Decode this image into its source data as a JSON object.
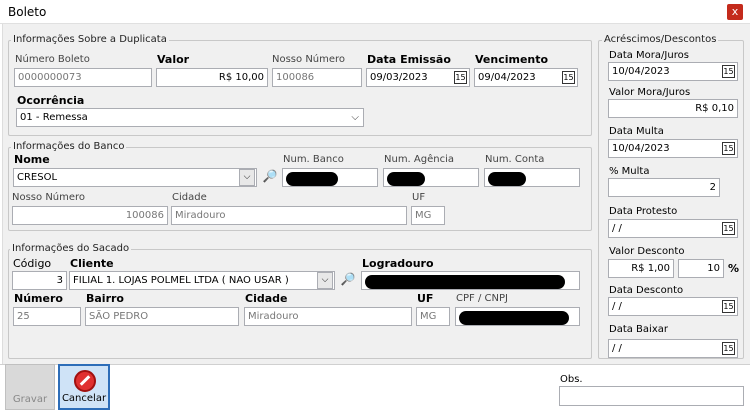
{
  "window": {
    "title": "Boleto",
    "close": "x"
  },
  "duplicata": {
    "group_label": "Informações Sobre a Duplicata",
    "numero_label": "Número Boleto",
    "numero_value": "0000000073",
    "valor_label": "Valor",
    "valor_value": "R$ 10,00",
    "nosso_label": "Nosso Número",
    "nosso_value": "100086",
    "emissao_label": "Data Emissão",
    "emissao_value": "09/03/2023",
    "vencimento_label": "Vencimento",
    "vencimento_value": "09/04/2023",
    "ocorrencia_label": "Ocorrência",
    "ocorrencia_value": "01 - Remessa"
  },
  "banco": {
    "group_label": "Informações do Banco",
    "nome_label": "Nome",
    "nome_value": "CRESOL",
    "num_banco_label": "Num. Banco",
    "num_agencia_label": "Num. Agência",
    "num_conta_label": "Num. Conta",
    "nosso_label": "Nosso Número",
    "nosso_value": "100086",
    "cidade_label": "Cidade",
    "cidade_value": "Miradouro",
    "uf_label": "UF",
    "uf_value": "MG"
  },
  "sacado": {
    "group_label": "Informações do Sacado",
    "codigo_label": "Código",
    "codigo_value": "3",
    "cliente_label": "Cliente",
    "cliente_value": "FILIAL 1. LOJAS POLMEL LTDA ( NAO USAR )",
    "logradouro_label": "Logradouro",
    "numero_label": "Número",
    "numero_value": "25",
    "bairro_label": "Bairro",
    "bairro_value": "SÃO PEDRO",
    "cidade_label": "Cidade",
    "cidade_value": "Miradouro",
    "uf_label": "UF",
    "uf_value": "MG",
    "cpf_label": "CPF / CNPJ"
  },
  "acrescimos": {
    "group_label": "Acréscimos/Descontos",
    "mora_data_label": "Data Mora/Juros",
    "mora_data_value": "10/04/2023",
    "mora_valor_label": "Valor Mora/Juros",
    "mora_valor_value": "R$ 0,10",
    "multa_data_label": "Data Multa",
    "multa_data_value": "10/04/2023",
    "multa_pct_label": "% Multa",
    "multa_pct_value": "2",
    "protesto_label": "Data Protesto",
    "protesto_value": " / /",
    "desconto_valor_label": "Valor Desconto",
    "desconto_valor_value": "R$ 1,00",
    "desconto_pct_value": "10",
    "pct_sign": "%",
    "desconto_data_label": "Data Desconto",
    "desconto_data_value": " / /",
    "baixar_label": "Data Baixar",
    "baixar_value": " / /"
  },
  "footer": {
    "gravar": "Gravar",
    "cancelar": "Cancelar",
    "obs_label": "Obs."
  },
  "icons": {
    "calendar": "15",
    "search": "🔎",
    "dropdown": "⌵"
  }
}
